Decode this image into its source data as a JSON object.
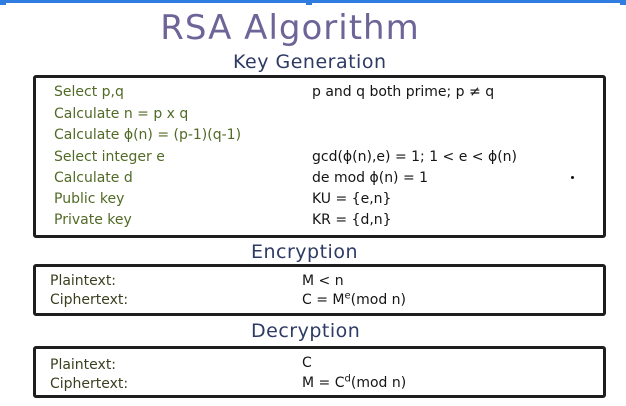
{
  "title": "RSA Algorithm",
  "key_generation": {
    "heading": "Key Generation",
    "rows": [
      {
        "label": "Select p,q",
        "value": "p and q both prime; p ≠ q"
      },
      {
        "label": "Calculate n = p x q",
        "value": ""
      },
      {
        "label": "Calculate ϕ(n) = (p-1)(q-1)",
        "value": ""
      },
      {
        "label": "Select integer e",
        "value": "gcd(ϕ(n),e) = 1; 1 < e < ϕ(n)"
      },
      {
        "label": "Calculate d",
        "value": "de mod ϕ(n) = 1"
      },
      {
        "label": "Public key",
        "value": "KU = {e,n}"
      },
      {
        "label": "Private key",
        "value": "KR = {d,n}"
      }
    ]
  },
  "encryption": {
    "heading": "Encryption",
    "rows": [
      {
        "label": "Plaintext:",
        "value": "M < n"
      },
      {
        "label": "Ciphertext:",
        "value_base": "C = M",
        "value_sup": "e",
        "value_tail": "(mod n)"
      }
    ]
  },
  "decryption": {
    "heading": "Decryption",
    "rows": [
      {
        "label": "Plaintext:",
        "value": "C"
      },
      {
        "label": "Ciphertext:",
        "value_base": "M = C",
        "value_sup": "d",
        "value_tail": "(mod n)"
      }
    ]
  }
}
